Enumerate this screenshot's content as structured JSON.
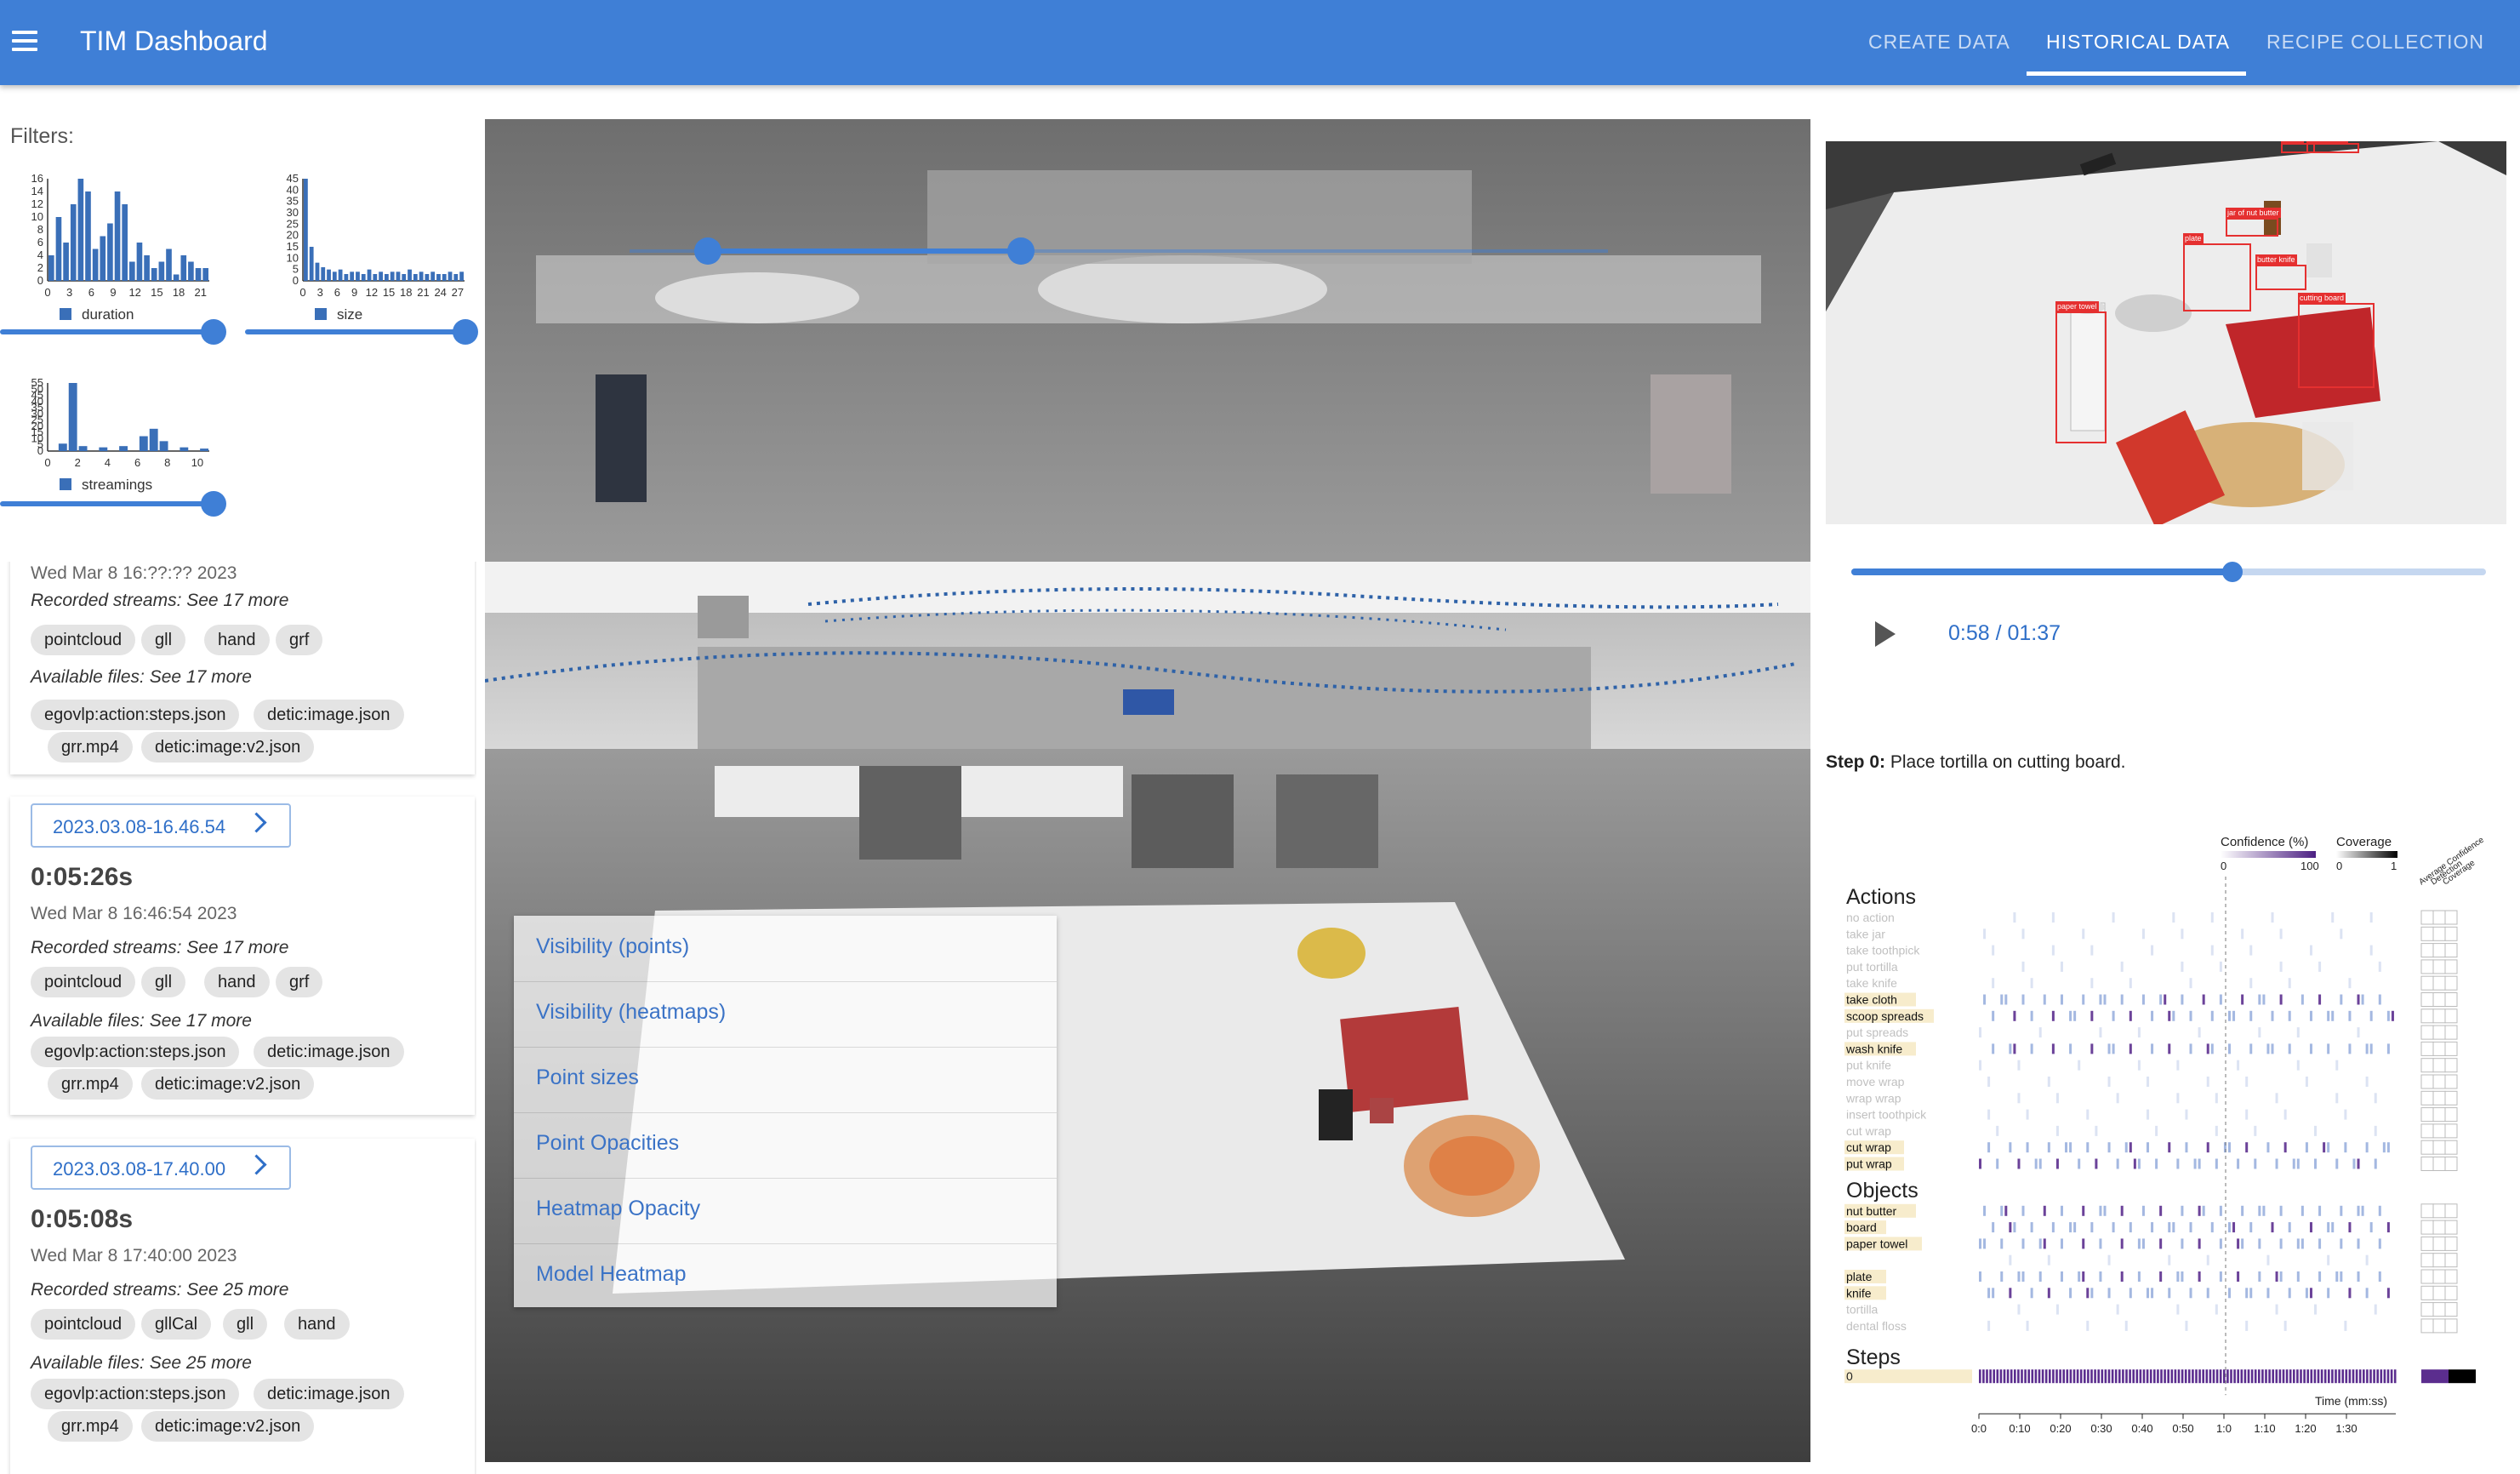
{
  "app": {
    "title": "TIM Dashboard"
  },
  "nav": {
    "tabs": [
      "CREATE DATA",
      "HISTORICAL DATA",
      "RECIPE COLLECTION"
    ],
    "active": "HISTORICAL DATA"
  },
  "filters": {
    "label": "Filters:",
    "duration": {
      "legend": "duration",
      "y_ticks": [
        "16",
        "14",
        "12",
        "10",
        "8",
        "6",
        "4",
        "2",
        "0"
      ],
      "x_ticks": [
        "0",
        "3",
        "6",
        "9",
        "12",
        "15",
        "18",
        "21"
      ],
      "bins": [
        4,
        10,
        6,
        12,
        16,
        14,
        5,
        7,
        9,
        14,
        12,
        3,
        6,
        4,
        2,
        3,
        5,
        1,
        4,
        3,
        2,
        2
      ]
    },
    "size": {
      "legend": "size",
      "y_ticks": [
        "45",
        "40",
        "35",
        "30",
        "25",
        "20",
        "15",
        "10",
        "5",
        "0"
      ],
      "x_ticks": [
        "0",
        "3",
        "6",
        "9",
        "12",
        "15",
        "18",
        "21",
        "24",
        "27"
      ],
      "bins": [
        45,
        15,
        8,
        6,
        5,
        4,
        5,
        3,
        4,
        4,
        3,
        5,
        3,
        4,
        3,
        4,
        4,
        3,
        5,
        3,
        4,
        3,
        4,
        3,
        3,
        4,
        3,
        4
      ]
    },
    "streamings": {
      "legend": "streamings",
      "y_ticks": [
        "55",
        "50",
        "45",
        "40",
        "35",
        "30",
        "25",
        "20",
        "15",
        "10",
        "5",
        "0"
      ],
      "x_ticks": [
        "0",
        "2",
        "4",
        "6",
        "8",
        "10"
      ],
      "bins": [
        0,
        6,
        55,
        4,
        0,
        3,
        0,
        4,
        0,
        12,
        18,
        8,
        0,
        3,
        0,
        2
      ]
    }
  },
  "recordings": [
    {
      "date_label": "",
      "duration": "",
      "timestamp": "Wed Mar 8 16:??:?? 2023",
      "streams_label": "Recorded streams: See 17 more",
      "streams": [
        "pointcloud",
        "gll",
        "hand",
        "grf"
      ],
      "files_label": "Available files: See 17 more",
      "files": [
        "egovlp:action:steps.json",
        "detic:image.json",
        "grr.mp4",
        "detic:image:v2.json"
      ]
    },
    {
      "date_label": "2023.03.08-16.46.54",
      "duration": "0:05:26s",
      "timestamp": "Wed Mar 8 16:46:54 2023",
      "streams_label": "Recorded streams: See 17 more",
      "streams": [
        "pointcloud",
        "gll",
        "hand",
        "grf"
      ],
      "files_label": "Available files: See 17 more",
      "files": [
        "egovlp:action:steps.json",
        "detic:image.json",
        "grr.mp4",
        "detic:image:v2.json"
      ]
    },
    {
      "date_label": "2023.03.08-17.40.00",
      "duration": "0:05:08s",
      "timestamp": "Wed Mar 8 17:40:00 2023",
      "streams_label": "Recorded streams: See 25 more",
      "streams": [
        "pointcloud",
        "gllCal",
        "gll",
        "hand"
      ],
      "files_label": "Available files: See 25 more",
      "files": [
        "egovlp:action:steps.json",
        "detic:image.json",
        "grr.mp4",
        "detic:image:v2.json"
      ]
    }
  ],
  "viewer": {
    "menu_items": [
      "Visibility (points)",
      "Visibility (heatmaps)",
      "Point sizes",
      "Point Opacities",
      "Heatmap Opacity",
      "Model Heatmap"
    ],
    "timeline": {
      "start": 0.08,
      "end": 0.4
    }
  },
  "video": {
    "detections": [
      "butter",
      "butter knife",
      "jar of nut butter",
      "plate",
      "butter knife",
      "cutting board",
      "paper towel"
    ],
    "time": "0:58 / 01:37",
    "progress": 0.6
  },
  "step": {
    "prefix": "Step 0:",
    "text": "Place tortilla on cutting board."
  },
  "chart": {
    "confidence_title": "Confidence (%)",
    "confidence_range": [
      "0",
      "100"
    ],
    "coverage_title": "Coverage",
    "coverage_range": [
      "0",
      "1"
    ],
    "col_titles": [
      "Average Confidence",
      "Detection",
      "Coverage"
    ],
    "actions_title": "Actions",
    "actions": [
      {
        "label": "no action",
        "active": false
      },
      {
        "label": "take jar",
        "active": false
      },
      {
        "label": "take toothpick",
        "active": false
      },
      {
        "label": "put tortilla",
        "active": false
      },
      {
        "label": "take knife",
        "active": false
      },
      {
        "label": "take cloth",
        "active": true
      },
      {
        "label": "scoop spreads",
        "active": true
      },
      {
        "label": "put spreads",
        "active": false
      },
      {
        "label": "wash knife",
        "active": true
      },
      {
        "label": "put knife",
        "active": false
      },
      {
        "label": "move wrap",
        "active": false
      },
      {
        "label": "wrap wrap",
        "active": false
      },
      {
        "label": "insert toothpick",
        "active": false
      },
      {
        "label": "cut wrap",
        "active": false
      },
      {
        "label": "cut wrap",
        "active": true
      },
      {
        "label": "put wrap",
        "active": true
      }
    ],
    "objects_title": "Objects",
    "objects": [
      {
        "label": "nut butter",
        "active": true
      },
      {
        "label": "board",
        "active": true
      },
      {
        "label": "paper towel",
        "active": true
      },
      {
        "label": "",
        "active": false
      },
      {
        "label": "plate",
        "active": true
      },
      {
        "label": "knife",
        "active": true
      },
      {
        "label": "tortilla",
        "active": false
      },
      {
        "label": "dental floss",
        "active": false
      }
    ],
    "steps_title": "Steps",
    "steps": [
      {
        "label": "0",
        "active": true
      }
    ],
    "x_title": "Time (mm:ss)",
    "x_ticks": [
      "0:0",
      "0:10",
      "0:20",
      "0:30",
      "0:40",
      "0:50",
      "1:0",
      "1:10",
      "1:20",
      "1:30"
    ]
  },
  "colors": {
    "primary": "#3f7fd6",
    "bar": "#3a6fb8",
    "heat_purple": "#5b2d8e",
    "heat_blue": "#9ab0de",
    "highlight": "#f7eccc"
  }
}
